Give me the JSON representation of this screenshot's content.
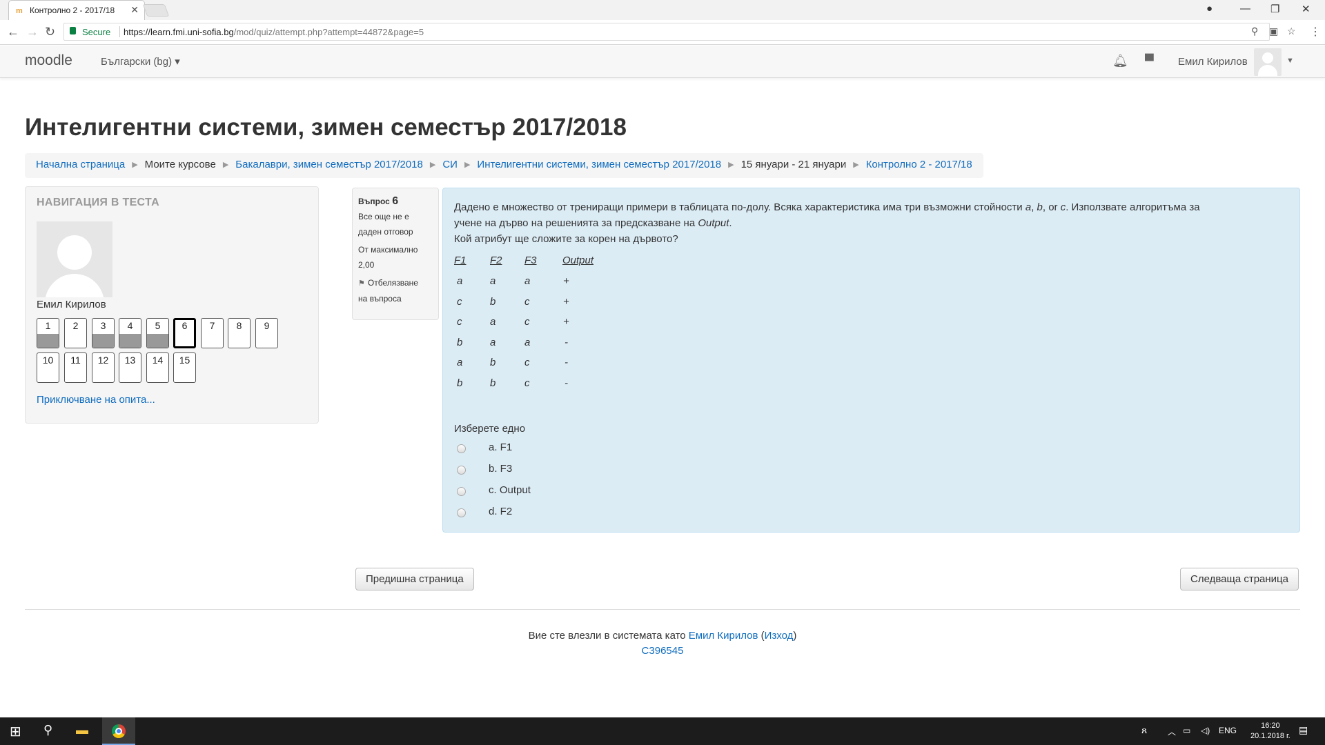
{
  "browser": {
    "tab_title": "Контролно 2 - 2017/18",
    "secure_label": "Secure",
    "url_host": "https://learn.fmi.uni-sofia.bg",
    "url_path": "/mod/quiz/attempt.php?attempt=44872&page=5"
  },
  "navbar": {
    "brand": "moodle",
    "language": "Български (bg)",
    "user_name": "Емил Кирилов"
  },
  "page_title": "Интелигентни системи, зимен семестър 2017/2018",
  "breadcrumb": [
    {
      "label": "Начална страница",
      "link": true
    },
    {
      "label": "Моите курсове",
      "link": false
    },
    {
      "label": "Бакалаври, зимен семестър 2017/2018",
      "link": true
    },
    {
      "label": "СИ",
      "link": true
    },
    {
      "label": "Интелигентни системи, зимен семестър 2017/2018",
      "link": true
    },
    {
      "label": "15 януари - 21 януари",
      "link": false
    },
    {
      "label": "Контролно 2 - 2017/18",
      "link": true
    }
  ],
  "quiz_nav": {
    "title": "НАВИГАЦИЯ В ТЕСТА",
    "user_name": "Емил Кирилов",
    "buttons": [
      {
        "label": "1",
        "state": "answered"
      },
      {
        "label": "2",
        "state": "notyet"
      },
      {
        "label": "3",
        "state": "answered"
      },
      {
        "label": "4",
        "state": "answered"
      },
      {
        "label": "5",
        "state": "answered"
      },
      {
        "label": "6",
        "state": "current"
      },
      {
        "label": "7",
        "state": "notyet"
      },
      {
        "label": "8",
        "state": "notyet"
      },
      {
        "label": "9",
        "state": "notyet"
      },
      {
        "label": "10",
        "state": "notyet"
      },
      {
        "label": "11",
        "state": "notyet"
      },
      {
        "label": "12",
        "state": "notyet"
      },
      {
        "label": "13",
        "state": "notyet"
      },
      {
        "label": "14",
        "state": "notyet"
      },
      {
        "label": "15",
        "state": "notyet"
      }
    ],
    "finish_link": "Приключване на опита..."
  },
  "question_info": {
    "label": "Въпрос",
    "number": "6",
    "state_line1": "Все още не е",
    "state_line2": "даден отговор",
    "grade_line1": "От максимално",
    "grade_line2": "2,00",
    "flag_line1": "Отбелязване",
    "flag_line2": "на въпроса"
  },
  "question": {
    "text1": "Дадено е множество от трениращи примери в таблицата по-долу. Всяка характеристика има три възможни стойности ",
    "val_a": "a",
    "comma1": ", ",
    "val_b": "b",
    "or": ", or ",
    "val_c": "c",
    "text2": ". Използвате алгоритъма за",
    "text3": "учене на дърво на решенията за предсказване на ",
    "output_word": "Output",
    "text3_end": ".",
    "text4": "Кой атрибут ще сложите за корен на дървото?",
    "table": {
      "headers": [
        "F1",
        "F2",
        "F3",
        "Output"
      ],
      "rows": [
        [
          "a",
          "a",
          "a",
          "+"
        ],
        [
          "c",
          "b",
          "c",
          "+"
        ],
        [
          "c",
          "a",
          "c",
          "+"
        ],
        [
          "b",
          "a",
          "a",
          "-"
        ],
        [
          "a",
          "b",
          "c",
          "-"
        ],
        [
          "b",
          "b",
          "c",
          "-"
        ]
      ]
    },
    "prompt": "Изберете едно",
    "options": [
      "a. F1",
      "b. F3",
      "c. Output",
      "d. F2"
    ]
  },
  "buttons": {
    "previous": "Предишна страница",
    "next": "Следваща страница"
  },
  "footer": {
    "logged_in_as": "Вие сте влезли в системата като ",
    "user": "Емил Кирилов",
    "open_paren": " (",
    "logout": "Изход",
    "close_paren": ")",
    "code": "C396545"
  },
  "taskbar": {
    "lang": "ENG",
    "time": "16:20",
    "date": "20.1.2018 г."
  }
}
